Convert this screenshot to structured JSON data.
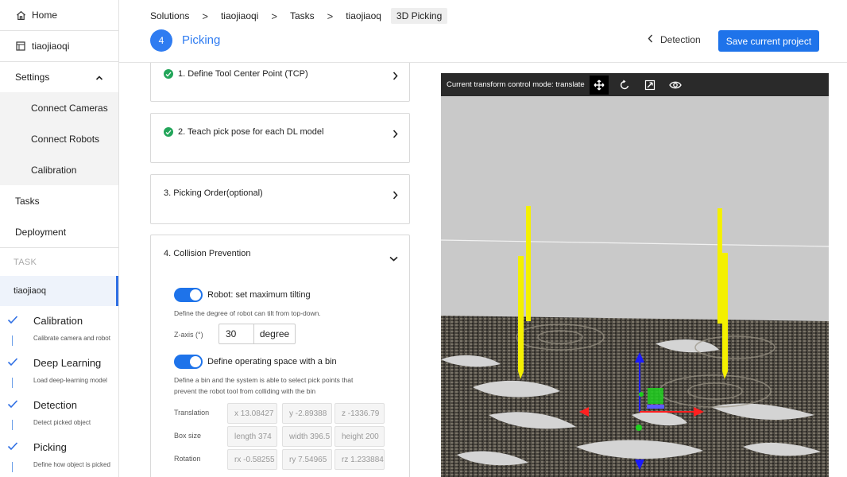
{
  "sidebar": {
    "home": "Home",
    "project": "tiaojiaoqi",
    "settings": "Settings",
    "settings_items": [
      "Connect Cameras",
      "Connect Robots",
      "Calibration"
    ],
    "tasks": "Tasks",
    "deployment": "Deployment",
    "task_header": "TASK",
    "active_task": "tiaojiaoq",
    "steps": [
      {
        "title": "Calibration",
        "desc": "Calibrate camera and robot"
      },
      {
        "title": "Deep Learning",
        "desc": "Load deep-learning model"
      },
      {
        "title": "Detection",
        "desc": "Detect picked object"
      },
      {
        "title": "Picking",
        "desc": "Define how object is picked"
      }
    ]
  },
  "breadcrumb": [
    "Solutions",
    "tiaojiaoqi",
    "Tasks",
    "tiaojiaoq",
    "3D Picking"
  ],
  "header": {
    "step_number": "4",
    "title": "Picking",
    "back_label": "Detection",
    "save_label": "Save current project"
  },
  "cards": {
    "c1": "1. Define Tool Center Point (TCP)",
    "c2": "2. Teach pick pose for each DL model",
    "c3": "3. Picking Order(optional)",
    "c4": "4. Collision Prevention"
  },
  "collision": {
    "tilt_label": "Robot: set maximum tilting",
    "tilt_desc": "Define the degree of robot can tilt from top-down.",
    "z_label": "Z-axis (°)",
    "z_value": "30",
    "z_unit": "degree",
    "bin_label": "Define operating space with a bin",
    "bin_desc1": "Define a bin and the system is able to select pick points that",
    "bin_desc2": "prevent the robot tool from colliding with the bin",
    "translation_label": "Translation",
    "translation": [
      "x 13.08427",
      "y -2.89388",
      "z -1336.79"
    ],
    "box_label": "Box size",
    "box": [
      "length 374",
      "width 396.5",
      "height 200"
    ],
    "rotation_label": "Rotation",
    "rotation": [
      "rx -0.58255",
      "ry 7.54965",
      "rz 1.233884"
    ]
  },
  "viewer": {
    "mode_text": "Current transform control mode: translate"
  },
  "colors": {
    "accent": "#1e73ea",
    "success": "#23a55a",
    "pin": "#f4f000"
  }
}
